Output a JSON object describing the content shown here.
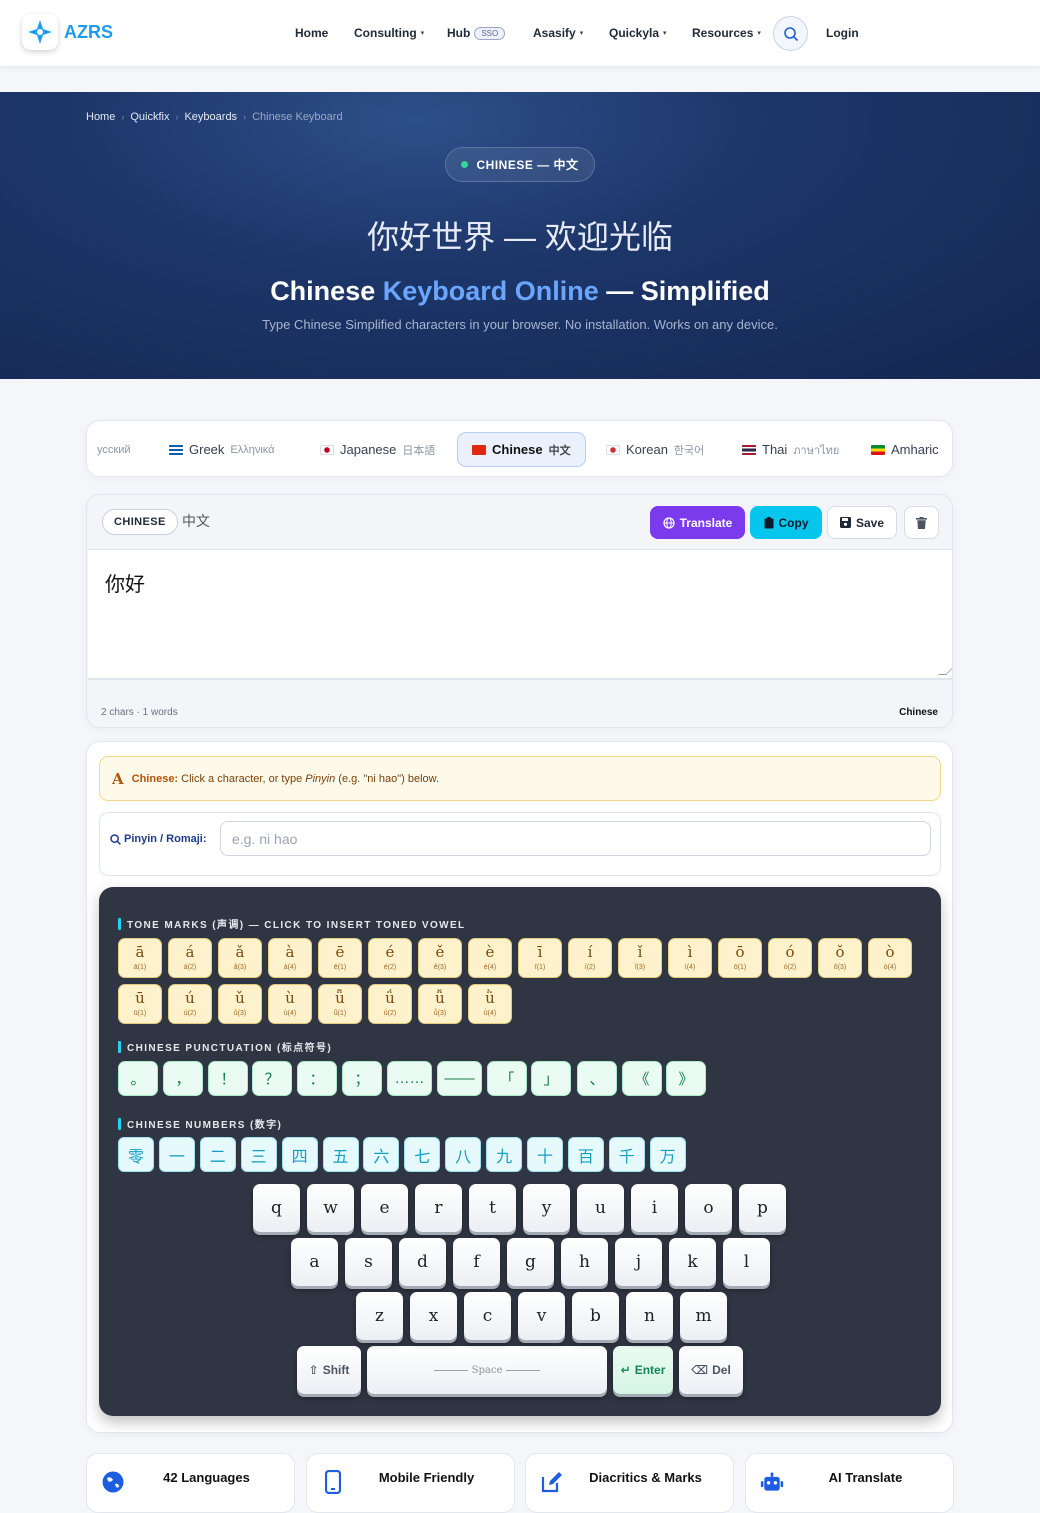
{
  "nav": {
    "brand": "AZRS",
    "items": [
      {
        "label": "Home",
        "caret": ""
      },
      {
        "label": "Consulting",
        "caret": "▾"
      },
      {
        "label": "Hub",
        "caret": ""
      },
      {
        "label": "Asasify",
        "caret": "▾"
      },
      {
        "label": "Quickyla",
        "caret": "▾"
      },
      {
        "label": "Resources",
        "caret": "▾"
      }
    ],
    "hub_badge": "SSO",
    "login": "Login"
  },
  "hero": {
    "breadcrumbs": [
      "Home",
      "Quickfix",
      "Keyboards",
      "Chinese Keyboard"
    ],
    "pill": "CHINESE — 中文",
    "greeting": "你好世界 — 欢迎光临",
    "title_start": "Chinese ",
    "title_highlight": "Keyboard Online",
    "title_end": " — Simplified",
    "subtitle": "Type Chinese Simplified characters in your browser. No installation. Works on any device."
  },
  "language_tabs": [
    {
      "name": "усский",
      "native": ""
    },
    {
      "name": "Greek",
      "native": "Ελληνικά"
    },
    {
      "name": "Japanese",
      "native": "日本語"
    },
    {
      "name": "Chinese",
      "native": "中文"
    },
    {
      "name": "Korean",
      "native": "한국어"
    },
    {
      "name": "Thai",
      "native": "ภาษาไทย"
    },
    {
      "name": "Amharic",
      "native": ""
    }
  ],
  "editor": {
    "lang_badge": "CHINESE",
    "lang_native": "中文",
    "translate": "Translate",
    "copy": "Copy",
    "save": "Save",
    "text": "你好",
    "stats": "2 chars · 1 words",
    "lang_label": "Chinese"
  },
  "hint": {
    "bold": "Chinese:",
    "before": " Click a character, or type ",
    "italic": "Pinyin",
    "after": " (e.g. \"ni hao\") below."
  },
  "pinyin": {
    "label": "Pinyin / Romaji:",
    "placeholder": "e.g. ni hao"
  },
  "sections": {
    "tones": "TONE MARKS (声调) — CLICK TO INSERT TONED VOWEL",
    "punct": "CHINESE PUNCTUATION (标点符号)",
    "numbers": "CHINESE NUMBERS (数字)"
  },
  "tone_keys": [
    {
      "g": "ā",
      "s": "ā(1)"
    },
    {
      "g": "á",
      "s": "á(2)"
    },
    {
      "g": "ǎ",
      "s": "ǎ(3)"
    },
    {
      "g": "à",
      "s": "à(4)"
    },
    {
      "g": "ē",
      "s": "ē(1)"
    },
    {
      "g": "é",
      "s": "é(2)"
    },
    {
      "g": "ě",
      "s": "ě(3)"
    },
    {
      "g": "è",
      "s": "è(4)"
    },
    {
      "g": "ī",
      "s": "ī(1)"
    },
    {
      "g": "í",
      "s": "í(2)"
    },
    {
      "g": "ǐ",
      "s": "ǐ(3)"
    },
    {
      "g": "ì",
      "s": "ì(4)"
    },
    {
      "g": "ō",
      "s": "ō(1)"
    },
    {
      "g": "ó",
      "s": "ó(2)"
    },
    {
      "g": "ǒ",
      "s": "ǒ(3)"
    },
    {
      "g": "ò",
      "s": "ò(4)"
    },
    {
      "g": "ū",
      "s": "ū(1)"
    },
    {
      "g": "ú",
      "s": "ú(2)"
    },
    {
      "g": "ǔ",
      "s": "ǔ(3)"
    },
    {
      "g": "ù",
      "s": "ù(4)"
    },
    {
      "g": "ǖ",
      "s": "ǖ(1)"
    },
    {
      "g": "ǘ",
      "s": "ǘ(2)"
    },
    {
      "g": "ǚ",
      "s": "ǚ(3)"
    },
    {
      "g": "ǜ",
      "s": "ǜ(4)"
    }
  ],
  "punct_keys": [
    "。",
    "，",
    "！",
    "？",
    "：",
    "；",
    "……",
    "——",
    "「",
    "」",
    "、",
    "《",
    "》"
  ],
  "number_keys": [
    "零",
    "一",
    "二",
    "三",
    "四",
    "五",
    "六",
    "七",
    "八",
    "九",
    "十",
    "百",
    "千",
    "万"
  ],
  "keyboard": {
    "row1": [
      "q",
      "w",
      "e",
      "r",
      "t",
      "y",
      "u",
      "i",
      "o",
      "p"
    ],
    "row2": [
      "a",
      "s",
      "d",
      "f",
      "g",
      "h",
      "j",
      "k",
      "l"
    ],
    "row3": [
      "z",
      "x",
      "c",
      "v",
      "b",
      "n",
      "m"
    ],
    "shift": "Shift",
    "space": "Space",
    "enter": "Enter",
    "del": "Del"
  },
  "features": [
    "42 Languages",
    "Mobile Friendly",
    "Diacritics & Marks",
    "AI Translate"
  ],
  "colors": {
    "accent_blue": "#1e9bf0",
    "translate_purple": "#7c3aed",
    "copy_cyan": "#06c6ee",
    "hero_navy": "#1d3669"
  }
}
